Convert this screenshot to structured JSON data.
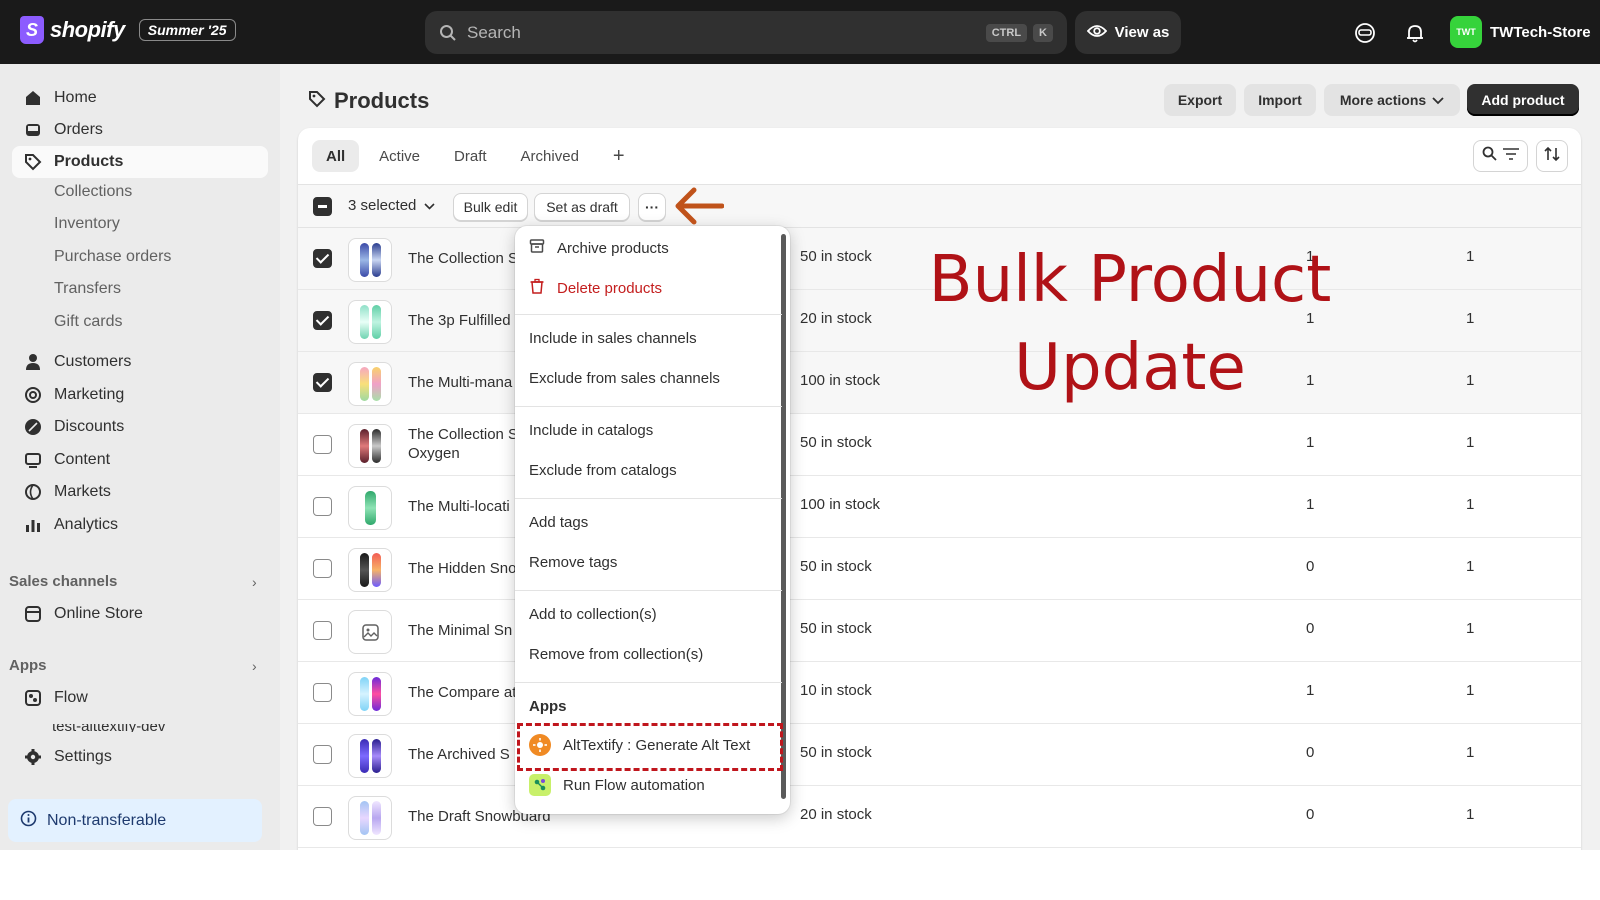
{
  "brand": {
    "name": "shopify",
    "edition": "Summer '25",
    "logo_letter": "S"
  },
  "topbar": {
    "search_placeholder": "Search",
    "shortcut_keys": [
      "CTRL",
      "K"
    ],
    "view_as_label": "View as",
    "store_name": "TWTech-Store",
    "store_initials": "TWT"
  },
  "sidebar": {
    "main_items": [
      {
        "label": "Home",
        "icon": "home-icon"
      },
      {
        "label": "Orders",
        "icon": "inbox-icon"
      },
      {
        "label": "Products",
        "icon": "tag-icon",
        "active": true
      }
    ],
    "product_subitems": [
      "Collections",
      "Inventory",
      "Purchase orders",
      "Transfers",
      "Gift cards"
    ],
    "more_items": [
      {
        "label": "Customers",
        "icon": "person-icon"
      },
      {
        "label": "Marketing",
        "icon": "target-icon"
      },
      {
        "label": "Discounts",
        "icon": "discount-icon"
      },
      {
        "label": "Content",
        "icon": "content-icon"
      },
      {
        "label": "Markets",
        "icon": "globe-icon"
      },
      {
        "label": "Analytics",
        "icon": "chart-bar-icon"
      }
    ],
    "sales_channels_label": "Sales channels",
    "online_store_label": "Online Store",
    "apps_label": "Apps",
    "flow_label": "Flow",
    "partial_app_label": "test-alttextify-dev",
    "settings_label": "Settings",
    "non_transferable_label": "Non-transferable"
  },
  "page": {
    "title": "Products",
    "actions": {
      "export": "Export",
      "import": "Import",
      "more_actions": "More actions",
      "add_product": "Add product"
    },
    "tabs": [
      {
        "label": "All",
        "active": true
      },
      {
        "label": "Active"
      },
      {
        "label": "Draft"
      },
      {
        "label": "Archived"
      }
    ],
    "add_tab_glyph": "+",
    "bulk": {
      "selected_label": "3 selected",
      "bulk_edit": "Bulk edit",
      "set_as_draft": "Set as draft",
      "more_glyph": "···"
    }
  },
  "products": [
    {
      "name": "The Collection S",
      "stock": "50 in stock",
      "col1": "1",
      "col2": "1",
      "checked": true
    },
    {
      "name": "The 3p Fulfilled",
      "stock": "20 in stock",
      "col1": "1",
      "col2": "1",
      "checked": true
    },
    {
      "name": "The Multi-mana",
      "stock": "100 in stock",
      "col1": "1",
      "col2": "1",
      "checked": true
    },
    {
      "name": "The Collection S",
      "name2": "Oxygen",
      "stock": "50 in stock",
      "col1": "1",
      "col2": "1",
      "checked": false
    },
    {
      "name": "The Multi-locati",
      "stock": "100 in stock",
      "col1": "1",
      "col2": "1",
      "checked": false
    },
    {
      "name": "The Hidden Sno",
      "stock": "50 in stock",
      "col1": "0",
      "col2": "1",
      "checked": false
    },
    {
      "name": "The Minimal Sn",
      "stock": "50 in stock",
      "col1": "0",
      "col2": "1",
      "checked": false
    },
    {
      "name": "The Compare at",
      "stock": "10 in stock",
      "col1": "1",
      "col2": "1",
      "checked": false
    },
    {
      "name": "The Archived S",
      "stock": "50 in stock",
      "col1": "0",
      "col2": "1",
      "checked": false
    },
    {
      "name": "The Draft Snowbuard",
      "stock": "20 in stock",
      "col1": "0",
      "col2": "1",
      "checked": false
    }
  ],
  "menu": {
    "archive": "Archive products",
    "delete": "Delete products",
    "include_channels": "Include in sales channels",
    "exclude_channels": "Exclude from sales channels",
    "include_catalogs": "Include in catalogs",
    "exclude_catalogs": "Exclude from catalogs",
    "add_tags": "Add tags",
    "remove_tags": "Remove tags",
    "add_collections": "Add to collection(s)",
    "remove_collections": "Remove from collection(s)",
    "apps_heading": "Apps",
    "alttextify": "AltTextify : Generate Alt Text",
    "run_flow": "Run Flow automation"
  },
  "annotation": {
    "line1": "Bulk Product",
    "line2": "Update",
    "color": "#b01217"
  },
  "colors": {
    "topbar": "#1a1a1a",
    "sidebar": "#ebebeb",
    "accent_green": "#36d33b",
    "danger": "#c41e1e",
    "arrow": "#c0531b"
  }
}
